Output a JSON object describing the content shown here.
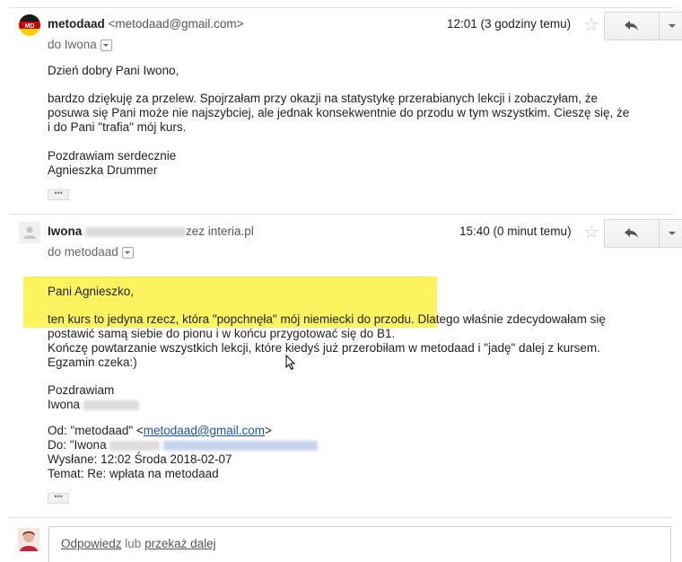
{
  "message1": {
    "sender_name": "metodaad",
    "sender_email": "<metodaad@gmail.com>",
    "avatar_text": "MD",
    "time": "12:01 (3 godziny temu)",
    "to_label": "do Iwona",
    "body": {
      "greeting": "Dzień dobry Pani Iwono,",
      "p1_line1": "bardzo dziękuję za przelew. Spojrzałam przy okazji na statystykę przerabianych lekcji i zobaczyłam, że",
      "p1_line2": "posuwa się Pani może nie najszybciej, ale jednak konsekwentnie do przodu w tym wszystkim. Cieszę się, że",
      "p1_line3": "i do Pani \"trafia\" mój kurs.",
      "closing": "Pozdrawiam serdecznie",
      "signature": "Agnieszka Drummer"
    }
  },
  "message2": {
    "sender_name": "Iwona",
    "sender_email_tail": "zez interia.pl",
    "time": "15:40 (0 minut temu)",
    "to_label": "do metodaad",
    "body": {
      "greeting": "Pani Agnieszko,",
      "line1": "ten kurs to jedyna rzecz, która \"popchnęła\" mój niemiecki do przodu. Dlatego właśnie zdecydowałam się",
      "line2": "postawić samą siebie do pionu i w końcu przygotować się do B1.",
      "line3": "Kończę powtarzanie wszystkich lekcji, które kiedyś już przerobiłam w metodaad i \"jadę\" dalej z kursem.",
      "line4": "Egzamin czeka:)",
      "closing": "Pozdrawiam",
      "signature_first": "Iwona"
    },
    "quoted": {
      "from_prefix": "Od: \"metodaad\" <",
      "from_email": "metodaad@gmail.com",
      "from_suffix": ">",
      "to_prefix": "Do: \"Iwona",
      "sent": "Wysłane: 12:02 Środa 2018-02-07",
      "subject": "Temat: Re: wpłata na metodaad"
    }
  },
  "reply": {
    "reply_link": "Odpowiedz",
    "or": " lub ",
    "forward_link": "przekaż dalej"
  },
  "colors": {
    "highlight": "#fbf45f",
    "link": "#1a55b5"
  }
}
